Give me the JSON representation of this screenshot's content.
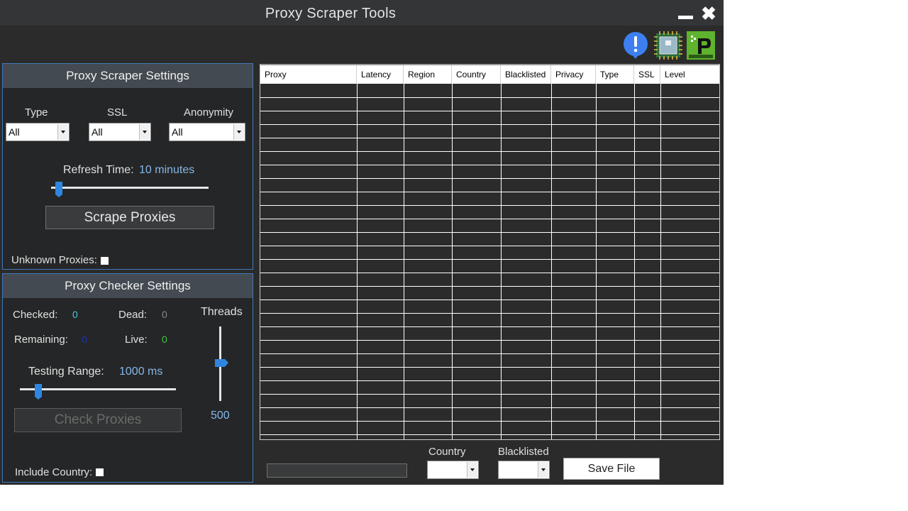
{
  "window": {
    "title": "Proxy Scraper Tools"
  },
  "top_icons": [
    "alert-icon",
    "chip-icon",
    "ipvanish-icon"
  ],
  "scraper": {
    "header": "Proxy Scraper Settings",
    "type_label": "Type",
    "type_value": "All",
    "ssl_label": "SSL",
    "ssl_value": "All",
    "anonymity_label": "Anonymity",
    "anonymity_value": "All",
    "refresh_label": "Refresh Time:",
    "refresh_value": "10 minutes",
    "scrape_button": "Scrape Proxies",
    "unknown_label": "Unknown Proxies:"
  },
  "checker": {
    "header": "Proxy Checker Settings",
    "checked_label": "Checked:",
    "checked_value": "0",
    "dead_label": "Dead:",
    "dead_value": "0",
    "remaining_label": "Remaining:",
    "remaining_value": "0",
    "live_label": "Live:",
    "live_value": "0",
    "threads_label": "Threads",
    "threads_value": "500",
    "testing_label": "Testing Range:",
    "testing_value": "1000 ms",
    "check_button": "Check Proxies",
    "include_country_label": "Include Country:"
  },
  "table": {
    "columns": [
      "Proxy",
      "Latency",
      "Region",
      "Country",
      "Blacklisted",
      "Privacy",
      "Type",
      "SSL",
      "Level"
    ]
  },
  "bottom": {
    "country_label": "Country",
    "blacklisted_label": "Blacklisted",
    "save_button": "Save File"
  },
  "colors": {
    "accent_blue": "#2f86e0",
    "checked_cyan": "#3fc7e8",
    "remaining_navy": "#1f35b0",
    "live_green": "#3cc83c"
  }
}
